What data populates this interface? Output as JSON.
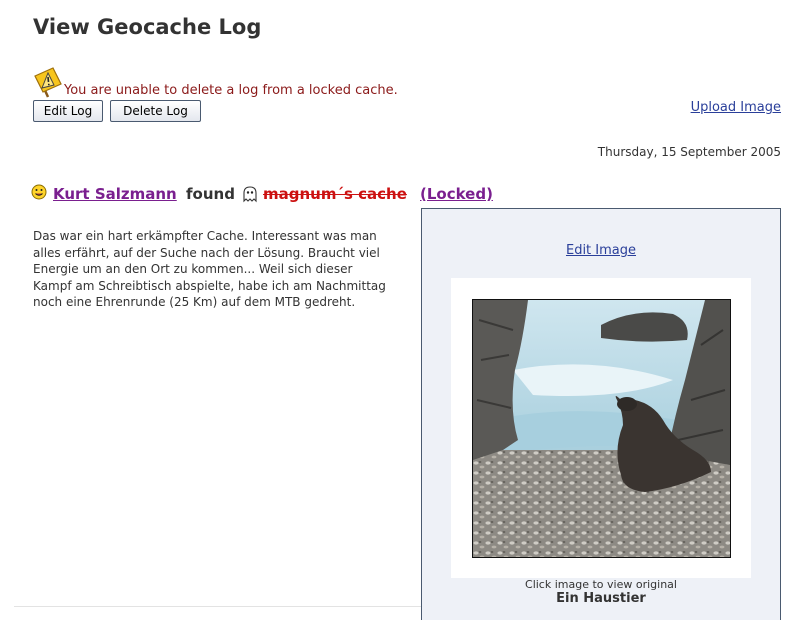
{
  "page": {
    "title": "View Geocache Log"
  },
  "warning": {
    "icon": "warning-sign-icon",
    "text": "You are unable to delete a log from a locked cache."
  },
  "toolbar": {
    "edit_label": "Edit Log",
    "delete_label": "Delete Log",
    "upload_label": "Upload Image"
  },
  "log": {
    "date": "Thursday, 15 September 2005",
    "type_icon": "smiley-icon",
    "finder": "Kurt Salzmann",
    "type": "found",
    "cache_type_icon": "ghost-icon",
    "cache_name": "magnum´s cache",
    "status": "(Locked)",
    "text": "Das war ein hart erkämpfter Cache. Interessant was man alles erfährt, auf der Suche nach der Lösung. Braucht viel Energie um an den Ort zu kommen... Weil sich dieser Kampf am Schreibtisch abspielte, habe ich am Nachmittag noch eine Ehrenrunde (25 Km) auf dem MTB gedreht."
  },
  "image": {
    "edit_label": "Edit Image",
    "caption": "Click image to view original",
    "title": "Ein Haustier"
  },
  "colors": {
    "link": "#2a3f9a",
    "visited_link": "#7a1f8f",
    "locked_cache": "#cc1111",
    "warning_text": "#8b1a1a",
    "panel_bg": "#eef1f7"
  }
}
